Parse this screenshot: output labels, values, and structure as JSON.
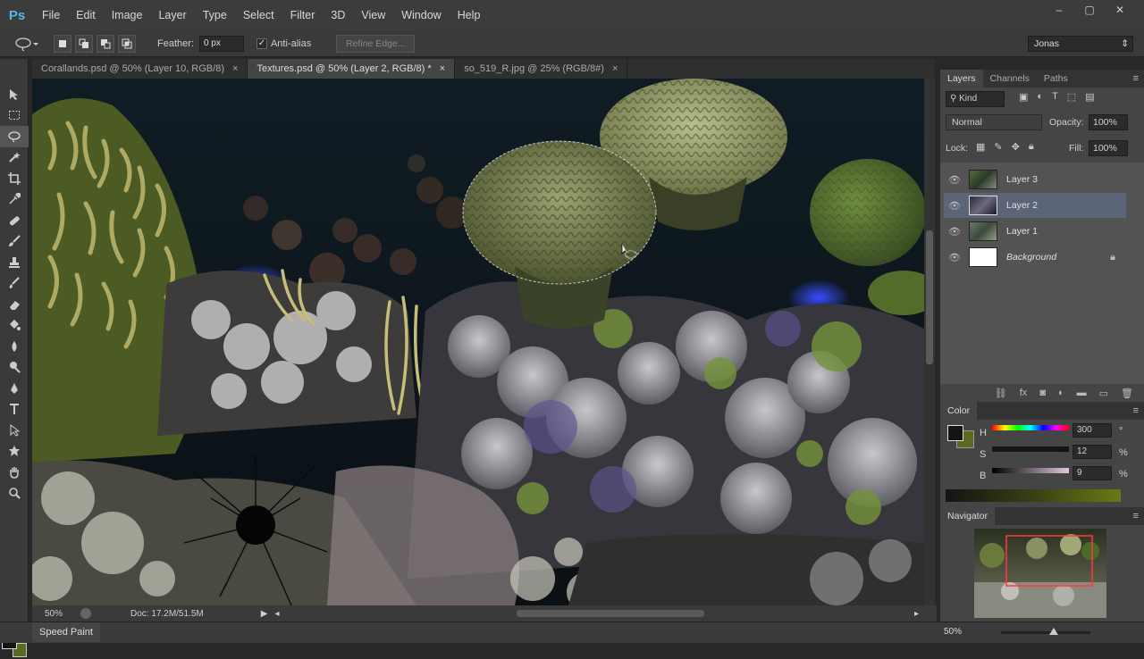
{
  "app": {
    "logo": "Ps"
  },
  "menu": [
    "File",
    "Edit",
    "Image",
    "Layer",
    "Type",
    "Select",
    "Filter",
    "3D",
    "View",
    "Window",
    "Help"
  ],
  "window_controls": {
    "minimize": "–",
    "maximize": "▢",
    "close": "✕"
  },
  "options_bar": {
    "feather_label": "Feather:",
    "feather_value": "0 px",
    "antialias_label": "Anti-alias",
    "antialias_check": "✓",
    "refine_edge": "Refine Edge...",
    "workspace": "Jonas",
    "select_arrow": "⇕"
  },
  "doc_tabs": [
    {
      "title": "Corallands.psd @ 50% (Layer 10, RGB/8)",
      "close": "×"
    },
    {
      "title": "Textures.psd @ 50% (Layer 2, RGB/8) *",
      "close": "×"
    },
    {
      "title": "so_519_R.jpg @ 25% (RGB/8#)",
      "close": "×"
    }
  ],
  "status": {
    "zoom": "50%",
    "doc": "Doc: 17.2M/51.5M"
  },
  "bottom": {
    "speed_paint": "Speed Paint",
    "nav_zoom": "50%"
  },
  "layers_panel": {
    "tabs": [
      "Layers",
      "Channels",
      "Paths"
    ],
    "kind": "Kind",
    "blend_mode": "Normal",
    "opacity_label": "Opacity:",
    "opacity": "100%",
    "lock_label": "Lock:",
    "fill_label": "Fill:",
    "fill": "100%",
    "layers": [
      {
        "name": "Layer 3"
      },
      {
        "name": "Layer 2"
      },
      {
        "name": "Layer 1"
      },
      {
        "name": "Background"
      }
    ],
    "footer_fx": "fx"
  },
  "color_panel": {
    "title": "Color",
    "h_label": "H",
    "h_value": "300",
    "h_unit": "°",
    "s_label": "S",
    "s_value": "12",
    "s_unit": "%",
    "b_label": "B",
    "b_value": "9",
    "b_unit": "%"
  },
  "navigator": {
    "title": "Navigator"
  },
  "colors": {
    "accent": "#5ab4f0",
    "selected_layer": "#5c6478",
    "nav_box": "#ff3b3b",
    "fg": "#141414",
    "bg": "#5a6a1e"
  }
}
